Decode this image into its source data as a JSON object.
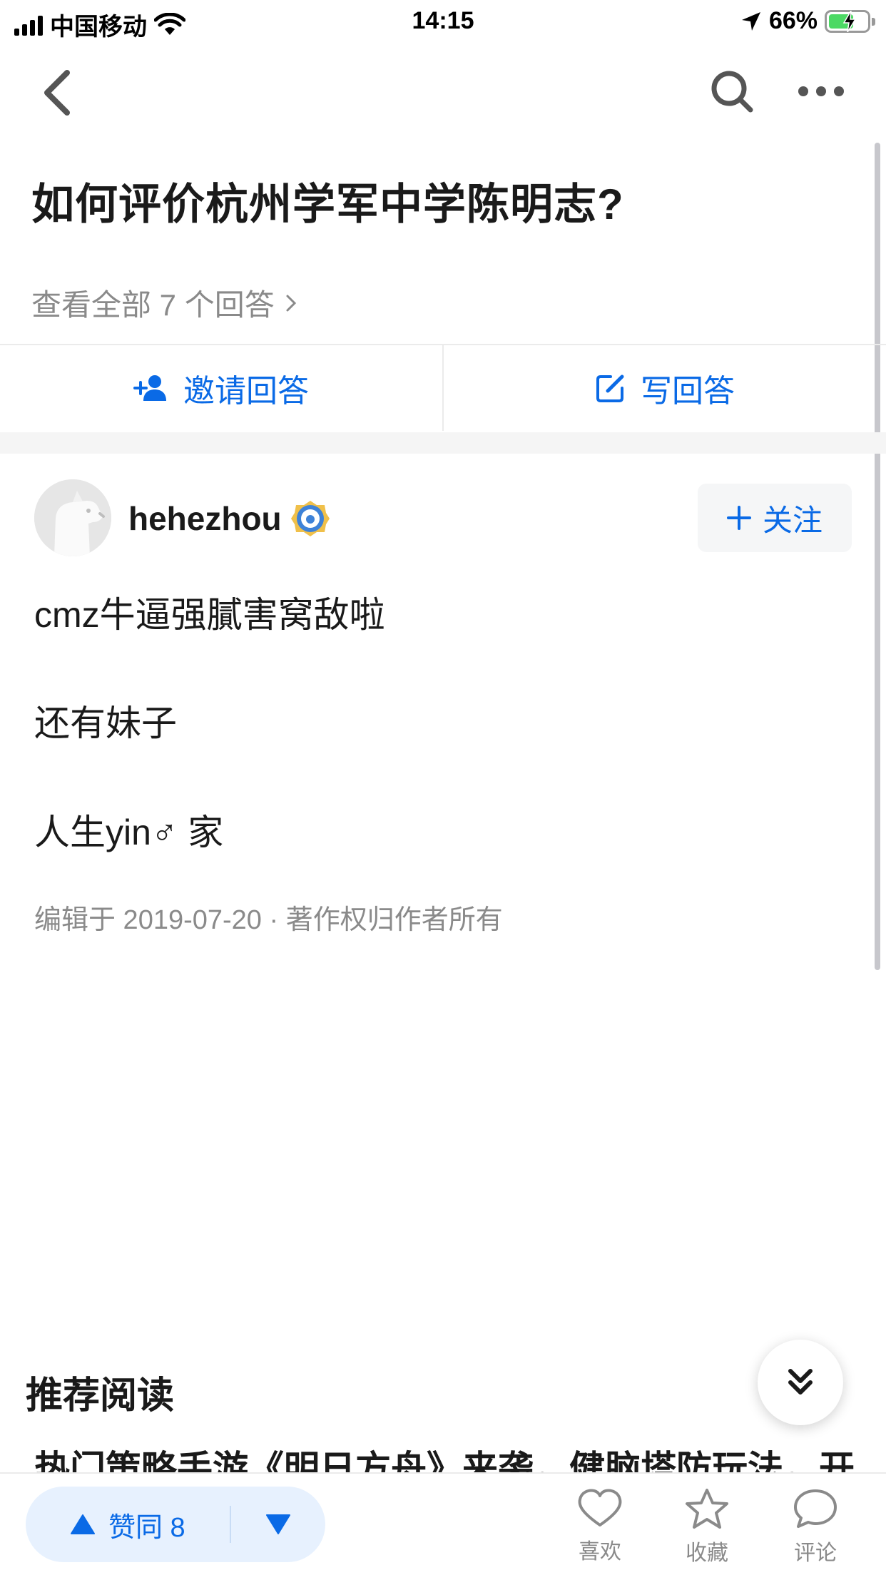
{
  "status_bar": {
    "carrier": "中国移动",
    "time": "14:15",
    "battery_percent": "66%",
    "battery_level": 0.66,
    "icons": [
      "signal-icon",
      "wifi-icon",
      "location-arrow-icon",
      "battery-icon",
      "charging-bolt-icon"
    ]
  },
  "nav": {
    "icons": [
      "back-icon",
      "search-icon",
      "more-icon"
    ]
  },
  "question": {
    "title": "如何评价杭州学军中学陈明志?",
    "view_all": "查看全部 7 个回答"
  },
  "actions": {
    "invite": "邀请回答",
    "write": "写回答"
  },
  "answer": {
    "username": "hehezhou",
    "follow_label": "关注",
    "paragraphs": [
      "cmz牛逼强膩害窝敌啦",
      "还有妹子",
      "人生yin♂ 家"
    ],
    "meta": "编辑于 2019-07-20 · 著作权归作者所有"
  },
  "recommend": {
    "title": "推荐阅读",
    "item_text": "热门策略手游《明日方舟》来袭，健脑塔防玩法，开"
  },
  "bottom_bar": {
    "agree_label": "赞同 8",
    "like_label": "喜欢",
    "favorite_label": "收藏",
    "comment_label": "评论"
  },
  "colors": {
    "accent": "#0a6ae6",
    "vote_bg": "#e7f1fe",
    "muted_text": "#8a8a8a",
    "battery_green": "#4cd964"
  }
}
